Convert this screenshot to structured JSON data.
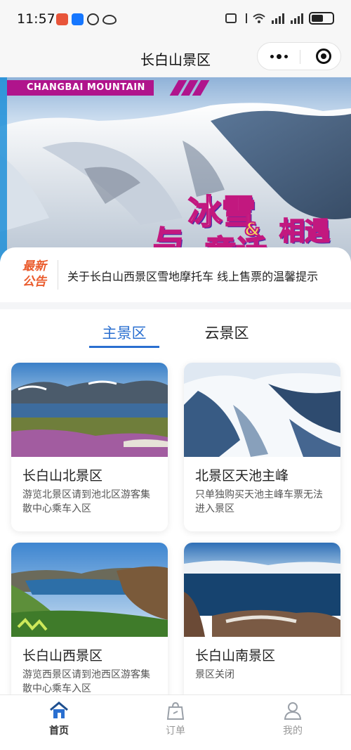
{
  "status_bar": {
    "time": "11:57"
  },
  "nav": {
    "title": "长白山景区"
  },
  "banner": {
    "tag": "CHANGBAI MOUNTAIN",
    "headline": [
      "与",
      "冰雪",
      "&",
      "童话",
      "相遇"
    ]
  },
  "notice": {
    "badge_line1": "最新",
    "badge_line2": "公告",
    "text": "关于长白山西景区雪地摩托车 线上售票的温馨提示"
  },
  "tabs": [
    {
      "label": "主景区",
      "active": true
    },
    {
      "label": "云景区",
      "active": false
    }
  ],
  "cards": [
    {
      "name": "长白山北景区",
      "desc": "游览北景区请到池北区游客集散中心乘车入区"
    },
    {
      "name": "北景区天池主峰",
      "desc": "只单独购买天池主峰车票无法进入景区"
    },
    {
      "name": "长白山西景区",
      "desc": "游览西景区请到池西区游客集散中心乘车入区"
    },
    {
      "name": "长白山南景区",
      "desc": "景区关闭"
    }
  ],
  "tabbar": [
    {
      "label": "首页",
      "icon": "home-icon",
      "active": true
    },
    {
      "label": "订单",
      "icon": "order-bag-icon",
      "active": false
    },
    {
      "label": "我的",
      "icon": "user-icon",
      "active": false
    }
  ],
  "colors": {
    "accent": "#2a6fd0",
    "notice": "#ea5b2c",
    "banner_tag": "#b0148c"
  }
}
